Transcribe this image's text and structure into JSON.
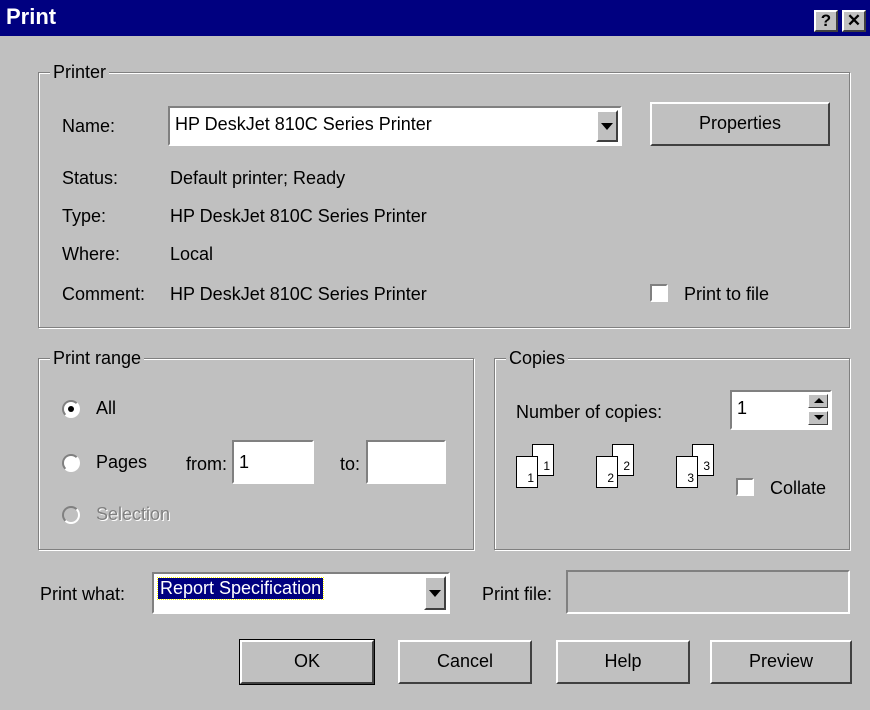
{
  "window": {
    "title": "Print",
    "help_glyph": "?",
    "close_glyph": "✕"
  },
  "printer": {
    "group_label": "Printer",
    "name_label": "Name:",
    "name_value": "HP DeskJet 810C Series Printer",
    "properties_label": "Properties",
    "status_label": "Status:",
    "status_value": "Default printer; Ready",
    "type_label": "Type:",
    "type_value": "HP DeskJet 810C Series Printer",
    "where_label": "Where:",
    "where_value": "Local",
    "comment_label": "Comment:",
    "comment_value": "HP DeskJet 810C Series Printer",
    "print_to_file_label": "Print to file",
    "print_to_file_checked": false
  },
  "print_range": {
    "group_label": "Print range",
    "all_label": "All",
    "pages_label": "Pages",
    "from_label": "from:",
    "from_value": "1",
    "to_label": "to:",
    "to_value": "",
    "selection_label": "Selection",
    "selected": "all"
  },
  "copies": {
    "group_label": "Copies",
    "number_label": "Number of copies:",
    "number_value": "1",
    "collate_label": "Collate",
    "collate_checked": false,
    "page_icons": [
      "1",
      "1",
      "2",
      "2",
      "3",
      "3"
    ]
  },
  "print_what": {
    "label": "Print what:",
    "value": "Report Specification"
  },
  "print_file": {
    "label": "Print file:",
    "value": ""
  },
  "buttons": {
    "ok": "OK",
    "cancel": "Cancel",
    "help": "Help",
    "preview": "Preview"
  },
  "colors": {
    "title_bar": "#000080",
    "dialog_face": "#c0c0c0",
    "selection": "#000080"
  }
}
